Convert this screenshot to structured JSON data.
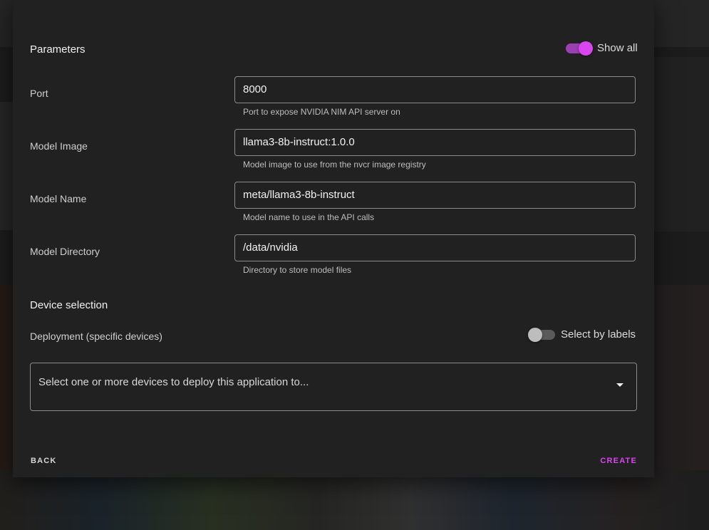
{
  "parameters": {
    "title": "Parameters",
    "show_all_label": "Show all",
    "show_all_enabled": true,
    "fields": [
      {
        "label": "Port",
        "value": "8000",
        "helper": "Port to expose NVIDIA NIM API server on"
      },
      {
        "label": "Model Image",
        "value": "llama3-8b-instruct:1.0.0",
        "helper": "Model image to use from the nvcr image registry"
      },
      {
        "label": "Model Name",
        "value": "meta/llama3-8b-instruct",
        "helper": "Model name to use in the API calls"
      },
      {
        "label": "Model Directory",
        "value": "/data/nvidia",
        "helper": "Directory to store model files"
      }
    ]
  },
  "device_selection": {
    "title": "Device selection",
    "deployment_label": "Deployment (specific devices)",
    "select_by_labels_label": "Select by labels",
    "select_by_labels_enabled": false,
    "select_placeholder": "Select one or more devices to deploy this application to..."
  },
  "actions": {
    "back_label": "BACK",
    "create_label": "CREATE"
  },
  "colors": {
    "accent": "#d946ef",
    "accent_track": "#9c3fb0"
  }
}
